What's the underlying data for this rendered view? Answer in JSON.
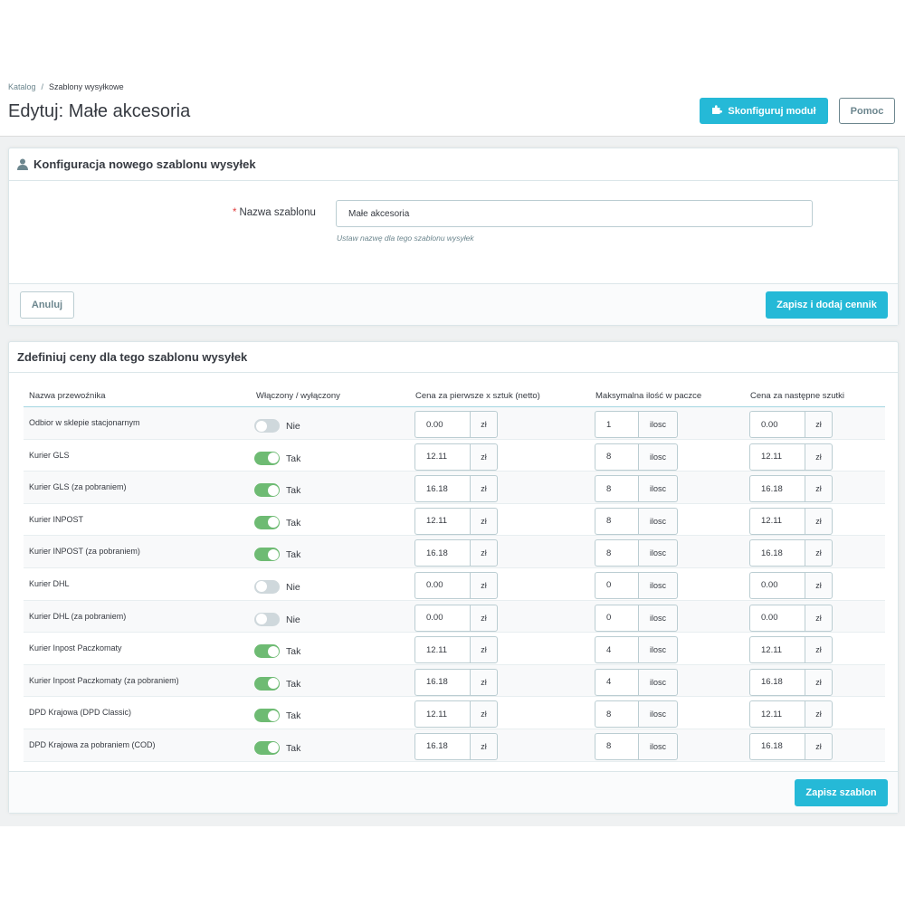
{
  "breadcrumb": {
    "parent": "Katalog",
    "separator": "/",
    "current": "Szablony wysyłkowe"
  },
  "page_title": "Edytuj: Małe akcesoria",
  "toolbar": {
    "module_label": "Skonfiguruj moduł",
    "help_label": "Pomoc"
  },
  "colors": {
    "accent": "#25b9d7",
    "toggle_on": "#6ebb73",
    "toggle_off": "#cfd8dc",
    "required": "#e04040"
  },
  "config_panel": {
    "title": "Konfiguracja nowego szablonu wysyłek",
    "name_label": "Nazwa szablonu",
    "required_mark": "*",
    "name_value": "Małe akcesoria",
    "help_text": "Ustaw nazwę dla tego szablonu wysyłek",
    "cancel_label": "Anuluj",
    "save_add_label": "Zapisz i dodaj cennik"
  },
  "prices_panel": {
    "title": "Zdefiniuj ceny dla tego szablonu wysyłek",
    "columns": [
      "Nazwa przewoźnika",
      "Włączony / wyłączony",
      "Cena za pierwsze x sztuk (netto)",
      "Maksymalna ilość w paczce",
      "Cena za następne szutki"
    ],
    "units": {
      "price": "zł",
      "qty": "ilosc"
    },
    "rows": [
      {
        "carrier": "Odbior w sklepie stacjonarnym",
        "enabled": false,
        "status": "Nie",
        "first_price": "0.00",
        "max_qty": "1",
        "next_price": "0.00"
      },
      {
        "carrier": "Kurier GLS",
        "enabled": true,
        "status": "Tak",
        "first_price": "12.11",
        "max_qty": "8",
        "next_price": "12.11"
      },
      {
        "carrier": "Kurier GLS (za pobraniem)",
        "enabled": true,
        "status": "Tak",
        "first_price": "16.18",
        "max_qty": "8",
        "next_price": "16.18"
      },
      {
        "carrier": "Kurier INPOST",
        "enabled": true,
        "status": "Tak",
        "first_price": "12.11",
        "max_qty": "8",
        "next_price": "12.11"
      },
      {
        "carrier": "Kurier INPOST (za pobraniem)",
        "enabled": true,
        "status": "Tak",
        "first_price": "16.18",
        "max_qty": "8",
        "next_price": "16.18"
      },
      {
        "carrier": "Kurier DHL",
        "enabled": false,
        "status": "Nie",
        "first_price": "0.00",
        "max_qty": "0",
        "next_price": "0.00"
      },
      {
        "carrier": "Kurier DHL (za pobraniem)",
        "enabled": false,
        "status": "Nie",
        "first_price": "0.00",
        "max_qty": "0",
        "next_price": "0.00"
      },
      {
        "carrier": "Kurier Inpost Paczkomaty",
        "enabled": true,
        "status": "Tak",
        "first_price": "12.11",
        "max_qty": "4",
        "next_price": "12.11"
      },
      {
        "carrier": "Kurier Inpost Paczkomaty (za pobraniem)",
        "enabled": true,
        "status": "Tak",
        "first_price": "16.18",
        "max_qty": "4",
        "next_price": "16.18"
      },
      {
        "carrier": "DPD Krajowa (DPD Classic)",
        "enabled": true,
        "status": "Tak",
        "first_price": "12.11",
        "max_qty": "8",
        "next_price": "12.11"
      },
      {
        "carrier": "DPD Krajowa za pobraniem (COD)",
        "enabled": true,
        "status": "Tak",
        "first_price": "16.18",
        "max_qty": "8",
        "next_price": "16.18"
      }
    ],
    "save_label": "Zapisz szablon"
  }
}
